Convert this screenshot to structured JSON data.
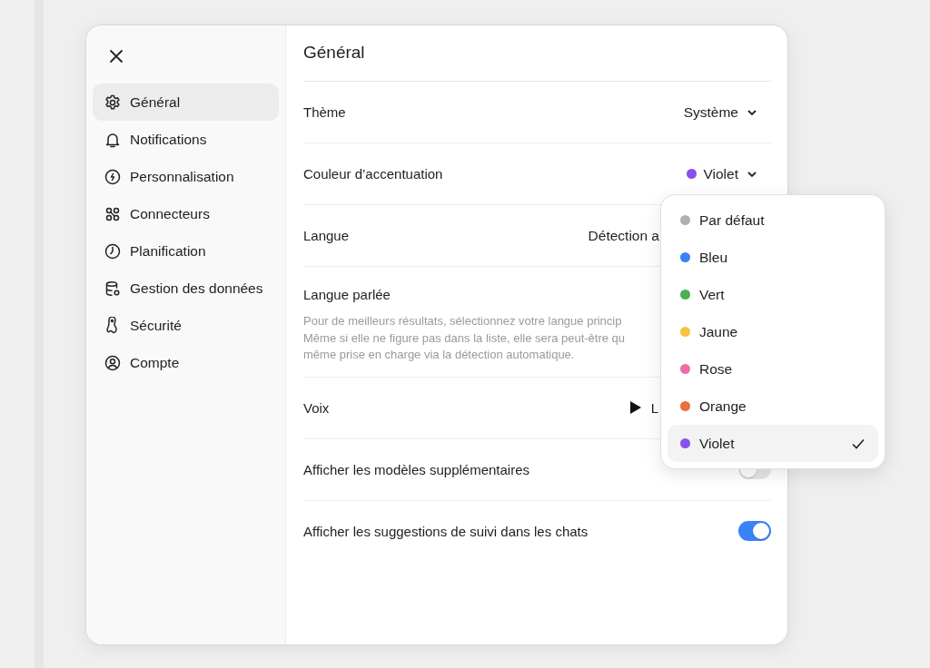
{
  "sidebar": {
    "items": [
      {
        "label": "Général",
        "selected": true
      },
      {
        "label": "Notifications",
        "selected": false
      },
      {
        "label": "Personnalisation",
        "selected": false
      },
      {
        "label": "Connecteurs",
        "selected": false
      },
      {
        "label": "Planification",
        "selected": false
      },
      {
        "label": "Gestion des données",
        "selected": false
      },
      {
        "label": "Sécurité",
        "selected": false
      },
      {
        "label": "Compte",
        "selected": false
      }
    ]
  },
  "panel": {
    "title": "Général",
    "settings": [
      {
        "kind": "select",
        "label": "Thème",
        "value": "Système"
      },
      {
        "kind": "select",
        "label": "Couleur d’accentuation",
        "value": "Violet",
        "color": "#8b50eb"
      },
      {
        "kind": "covered",
        "label": "Langue",
        "value": "Détection a"
      },
      {
        "kind": "described",
        "label": "Langue parlée",
        "description": "Pour de meilleurs résultats, sélectionnez votre langue princip\nMême si elle ne figure pas dans la liste, elle sera peut-être qu\nmême prise en charge via la détection automatique."
      },
      {
        "kind": "voice",
        "label": "Voix",
        "value": "L"
      },
      {
        "kind": "toggle",
        "label": "Afficher les modèles supplémentaires",
        "on": false
      },
      {
        "kind": "toggle",
        "label": "Afficher les suggestions de suivi dans les chats",
        "on": true
      }
    ]
  },
  "color_menu": {
    "options": [
      {
        "label": "Par défaut",
        "color": "#b0b0b0",
        "selected": false
      },
      {
        "label": "Bleu",
        "color": "#3b82f6",
        "selected": false
      },
      {
        "label": "Vert",
        "color": "#4caf50",
        "selected": false
      },
      {
        "label": "Jaune",
        "color": "#f6c343",
        "selected": false
      },
      {
        "label": "Rose",
        "color": "#ec6fa8",
        "selected": false
      },
      {
        "label": "Orange",
        "color": "#e9703a",
        "selected": false
      },
      {
        "label": "Violet",
        "color": "#8b50eb",
        "selected": true
      }
    ]
  }
}
